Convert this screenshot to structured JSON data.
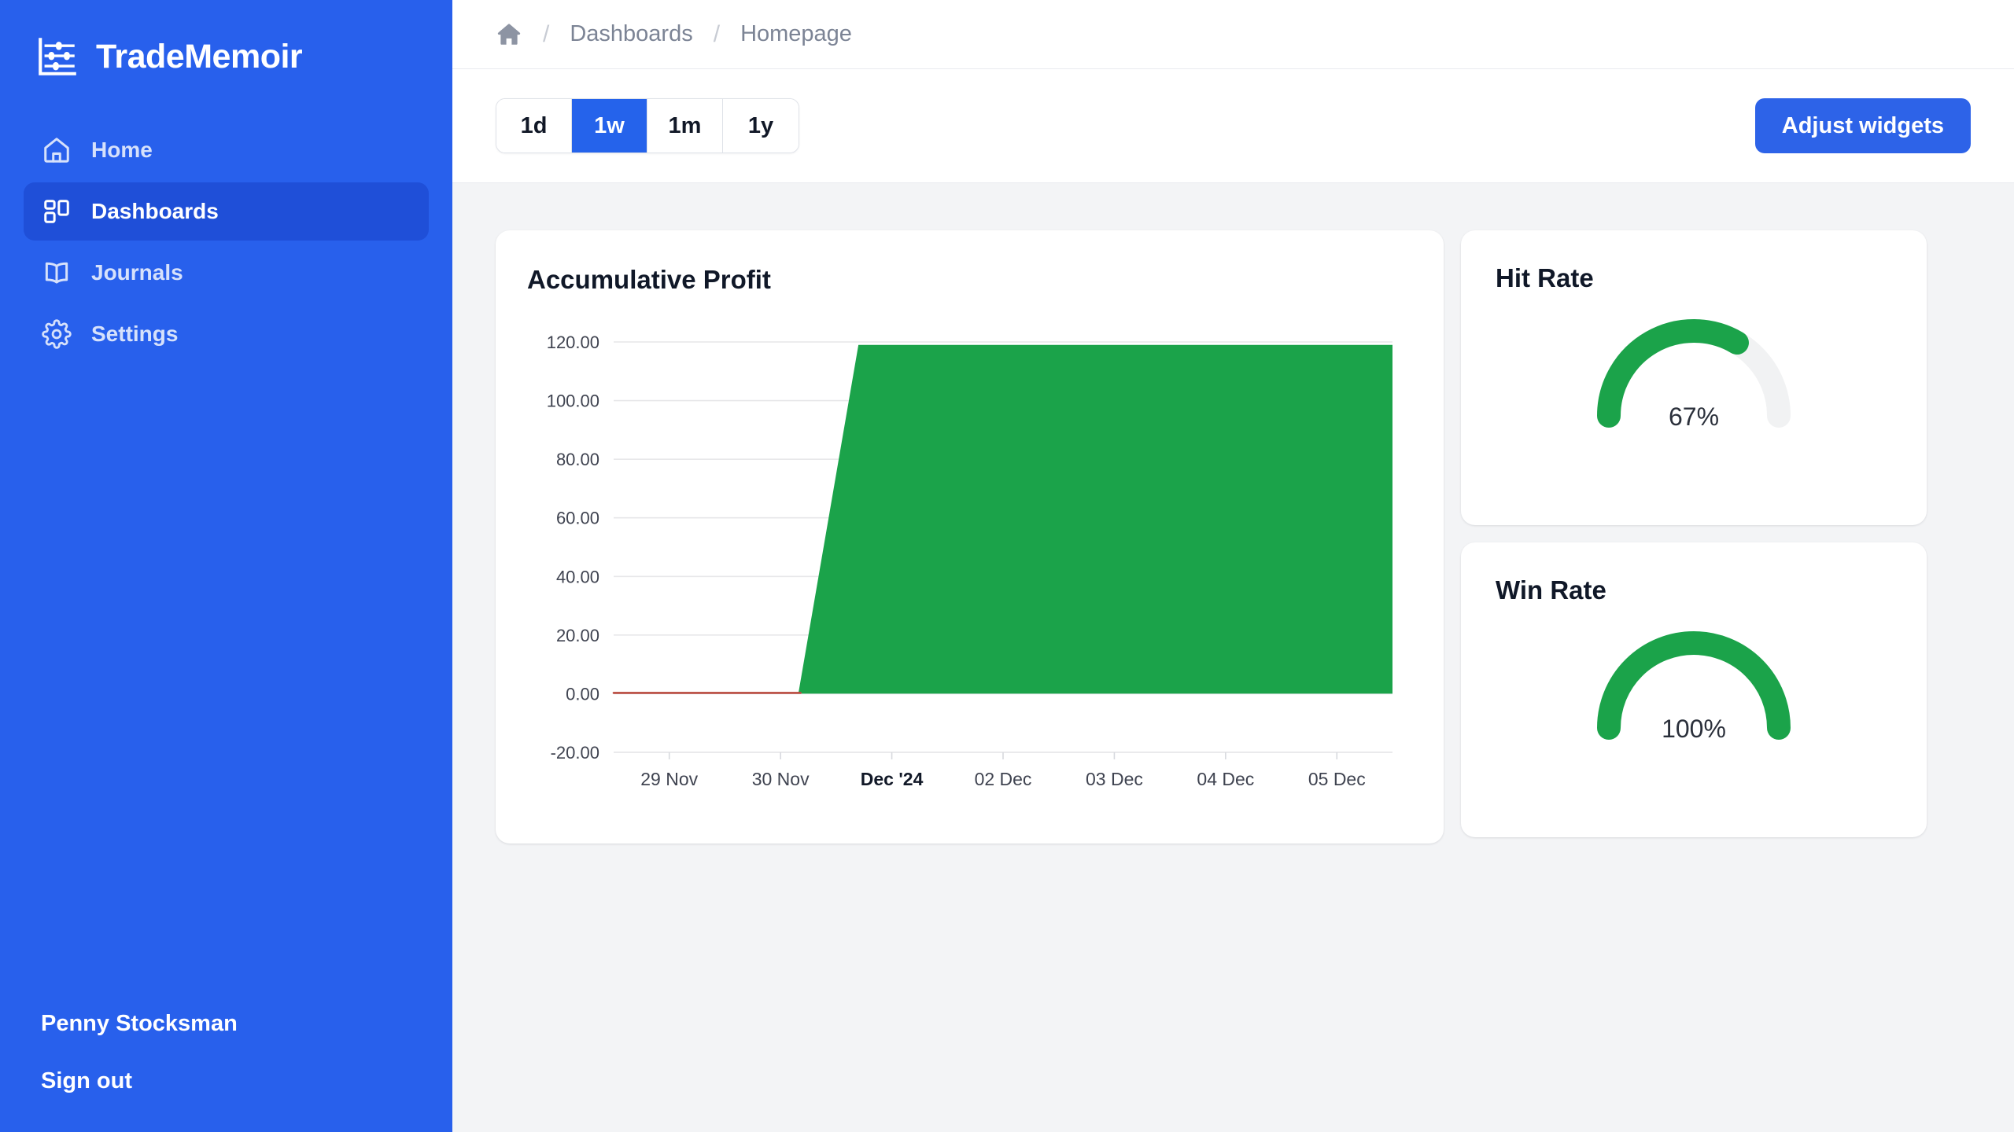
{
  "brand": {
    "name": "TradeMemoir",
    "logo_icon": "abacus-icon"
  },
  "sidebar": {
    "items": [
      {
        "label": "Home",
        "icon": "home-icon",
        "active": false
      },
      {
        "label": "Dashboards",
        "icon": "layout-dashboard-icon",
        "active": true
      },
      {
        "label": "Journals",
        "icon": "book-open-icon",
        "active": false
      },
      {
        "label": "Settings",
        "icon": "gear-icon",
        "active": false
      }
    ],
    "user_name": "Penny Stocksman",
    "sign_out_label": "Sign out",
    "background_color": "#2860ec",
    "active_item_color": "#1f4fd8"
  },
  "breadcrumb": {
    "home_icon": "home-filled-icon",
    "separator": "/",
    "items": [
      "Dashboards",
      "Homepage"
    ]
  },
  "toolbar": {
    "ranges": [
      {
        "label": "1d",
        "active": false
      },
      {
        "label": "1w",
        "active": true
      },
      {
        "label": "1m",
        "active": false
      },
      {
        "label": "1y",
        "active": false
      }
    ],
    "adjust_label": "Adjust widgets",
    "accent_color": "#2d63e8"
  },
  "widgets": {
    "profit_title": "Accumulative Profit",
    "hit_rate": {
      "title": "Hit Rate",
      "value_label": "67%",
      "percent": 67
    },
    "win_rate": {
      "title": "Win Rate",
      "value_label": "100%",
      "percent": 100
    }
  },
  "colors": {
    "green": "#1ba34a",
    "gauge_track": "#f1f2f3",
    "red_line": "#b94a3f",
    "grid": "#e7e7e9"
  },
  "chart_data": {
    "type": "area",
    "title": "Accumulative Profit",
    "xlabel": "",
    "ylabel": "",
    "ylim": [
      -20,
      120
    ],
    "yticks": [
      -20.0,
      0.0,
      20.0,
      40.0,
      60.0,
      80.0,
      100.0,
      120.0
    ],
    "ytick_labels": [
      "-20.00",
      "0.00",
      "20.00",
      "40.00",
      "60.00",
      "80.00",
      "100.00",
      "120.00"
    ],
    "categories": [
      "29 Nov",
      "30 Nov",
      "Dec '24",
      "02 Dec",
      "03 Dec",
      "04 Dec",
      "05 Dec"
    ],
    "xtick_bold": "Dec '24",
    "grid": true,
    "legend": "none",
    "series": [
      {
        "name": "Accumulative Profit",
        "color": "#1ba34a",
        "fill": true,
        "x": [
          "29 Nov",
          "30 Nov",
          "Dec '24",
          "02 Dec",
          "03 Dec",
          "04 Dec",
          "05 Dec"
        ],
        "values": [
          0,
          0,
          119,
          119,
          119,
          119,
          119
        ]
      },
      {
        "name": "Baseline",
        "color": "#b94a3f",
        "fill": false,
        "x": [
          "29 Nov",
          "30 Nov",
          "Dec '24"
        ],
        "values": [
          0,
          0,
          0
        ]
      }
    ]
  }
}
